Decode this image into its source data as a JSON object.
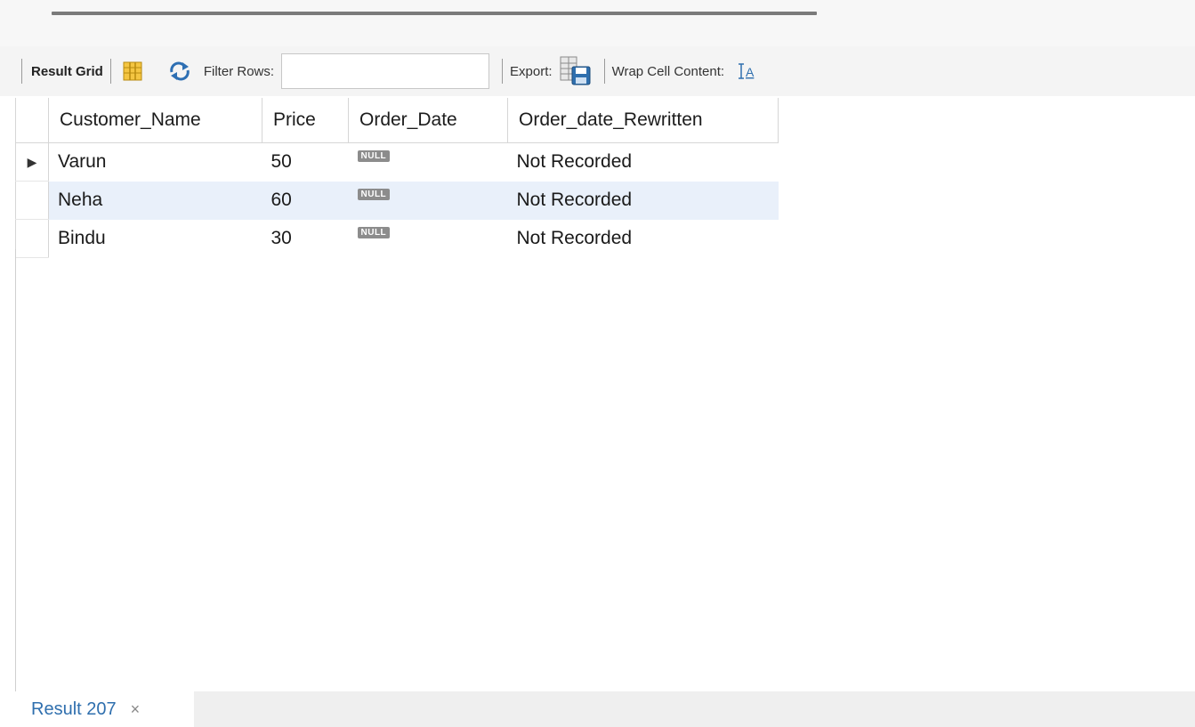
{
  "toolbar": {
    "result_grid_label": "Result Grid",
    "filter_label": "Filter Rows:",
    "filter_value": "",
    "export_label": "Export:",
    "wrap_label": "Wrap Cell Content:"
  },
  "grid": {
    "columns": [
      "Customer_Name",
      "Price",
      "Order_Date",
      "Order_date_Rewritten"
    ],
    "rows": [
      {
        "customer_name": "Varun",
        "price": "50",
        "order_date": "NULL",
        "order_date_rewritten": "Not Recorded",
        "marker": "▶"
      },
      {
        "customer_name": "Neha",
        "price": "60",
        "order_date": "NULL",
        "order_date_rewritten": "Not Recorded",
        "marker": ""
      },
      {
        "customer_name": "Bindu",
        "price": "30",
        "order_date": "NULL",
        "order_date_rewritten": "Not Recorded",
        "marker": ""
      }
    ]
  },
  "bottom_tabs": [
    {
      "label": "Result 207",
      "close": "×"
    }
  ],
  "icons": {
    "form_view": "grid-columns-icon",
    "refresh": "refresh-icon",
    "export": "export-save-icon",
    "wrap": "wrap-text-icon"
  },
  "colors": {
    "tab_text": "#2f6fae",
    "alt_row": "#e9f0fa",
    "null_badge": "#8c8c8c"
  }
}
